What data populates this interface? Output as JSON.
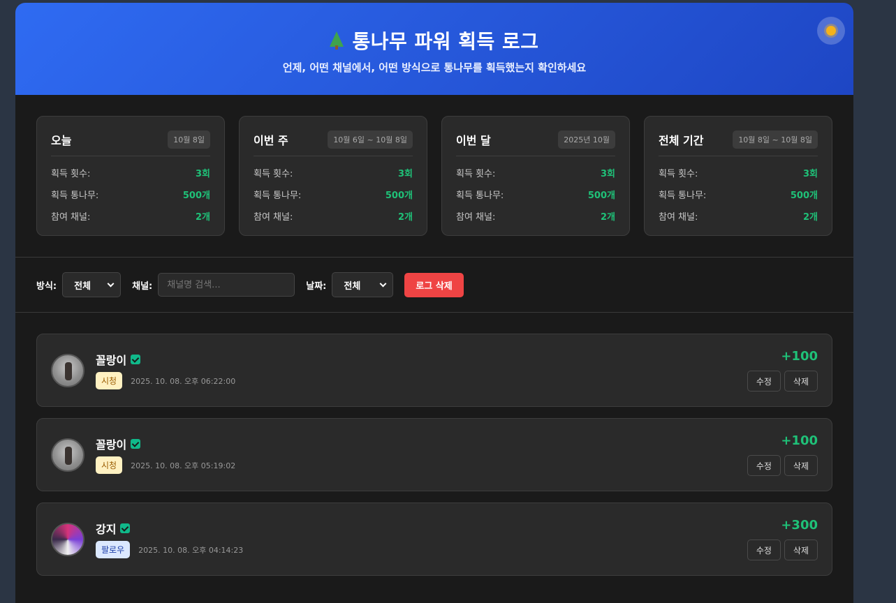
{
  "header": {
    "title": "통나무 파워 획득 로그",
    "subtitle": "언제, 어떤 채널에서, 어떤 방식으로 통나무를 획득했는지 확인하세요",
    "theme_icon": "sun-icon"
  },
  "stats": [
    {
      "title": "오늘",
      "range": "10월 8일",
      "rows": [
        {
          "label": "획득 횟수:",
          "value": "3회"
        },
        {
          "label": "획득 통나무:",
          "value": "500개"
        },
        {
          "label": "참여 채널:",
          "value": "2개"
        }
      ]
    },
    {
      "title": "이번 주",
      "range": "10월 6일 ~ 10월 8일",
      "rows": [
        {
          "label": "획득 횟수:",
          "value": "3회"
        },
        {
          "label": "획득 통나무:",
          "value": "500개"
        },
        {
          "label": "참여 채널:",
          "value": "2개"
        }
      ]
    },
    {
      "title": "이번 달",
      "range": "2025년 10월",
      "rows": [
        {
          "label": "획득 횟수:",
          "value": "3회"
        },
        {
          "label": "획득 통나무:",
          "value": "500개"
        },
        {
          "label": "참여 채널:",
          "value": "2개"
        }
      ]
    },
    {
      "title": "전체 기간",
      "range": "10월 8일 ~ 10월 8일",
      "rows": [
        {
          "label": "획득 횟수:",
          "value": "3회"
        },
        {
          "label": "획득 통나무:",
          "value": "500개"
        },
        {
          "label": "참여 채널:",
          "value": "2개"
        }
      ]
    }
  ],
  "filters": {
    "method_label": "방식:",
    "method_value": "전체",
    "channel_label": "채널:",
    "channel_placeholder": "채널명 검색...",
    "date_label": "날짜:",
    "date_value": "전체",
    "delete_button": "로그 삭제"
  },
  "logs": [
    {
      "name": "꼴랑이",
      "badge": "시청",
      "time": "2025. 10. 08. 오후 06:22:00",
      "amount": "+100",
      "edit": "수정",
      "delete": "삭제"
    },
    {
      "name": "꼴랑이",
      "badge": "시청",
      "time": "2025. 10. 08. 오후 05:19:02",
      "amount": "+100",
      "edit": "수정",
      "delete": "삭제"
    },
    {
      "name": "강지",
      "badge": "팔로우",
      "time": "2025. 10. 08. 오후 04:14:23",
      "amount": "+300",
      "edit": "수정",
      "delete": "삭제"
    }
  ],
  "colors": {
    "header_start": "#2f6bf2",
    "header_end": "#1e46c4",
    "accent_green": "#1fc178",
    "danger": "#ef4444",
    "badge_watch_bg": "#fff1c2",
    "badge_follow_bg": "#dbe8ff"
  }
}
